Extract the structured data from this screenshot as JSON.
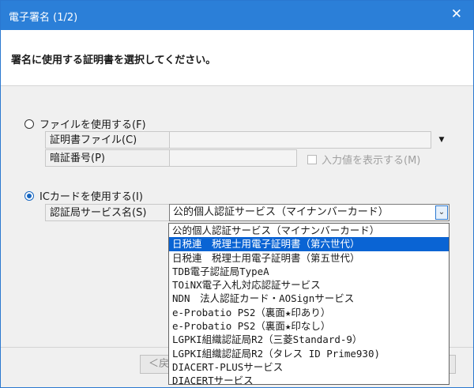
{
  "window": {
    "title": "電子署名 (1/2)",
    "close_glyph": "✕"
  },
  "instruction": "署名に使用する証明書を選択してください。",
  "file_option": {
    "label": "ファイルを使用する(F)",
    "cert_file_label": "証明書ファイル(C)",
    "cert_file_value": "",
    "dropdown_glyph": "▼",
    "pin_label": "暗証番号(P)",
    "pin_value": "",
    "show_input_label": "入力値を表示する(M)"
  },
  "ic_option": {
    "label": "ICカードを使用する(I)",
    "service_label": "認証局サービス名(S)",
    "service_selected": "公的個人認証サービス（マイナンバーカード）",
    "arrow_glyph": "⌄"
  },
  "dropdown_options": [
    "公的個人認証サービス（マイナンバーカード）",
    "日税連　税理士用電子証明書（第六世代）",
    "日税連　税理士用電子証明書（第五世代）",
    "TDB電子認証局TypeA",
    "TOiNX電子入札対応認証サービス",
    "NDN　法人認証カード・AOSignサービス",
    "e-Probatio PS2（裏面★印あり）",
    "e-Probatio PS2（裏面★印なし）",
    "LGPKI組織認証局R2（三菱Standard-9）",
    "LGPKI組織認証局R2（タレス ID Prime930)",
    "DIACERT-PLUSサービス",
    "DIACERTサービス"
  ],
  "highlighted_index": 1,
  "footer": {
    "back_label": "＜戻"
  },
  "colors": {
    "titlebar": "#2b7fd8",
    "selection": "#0a64d4",
    "radio_checked": "#1565c0"
  }
}
